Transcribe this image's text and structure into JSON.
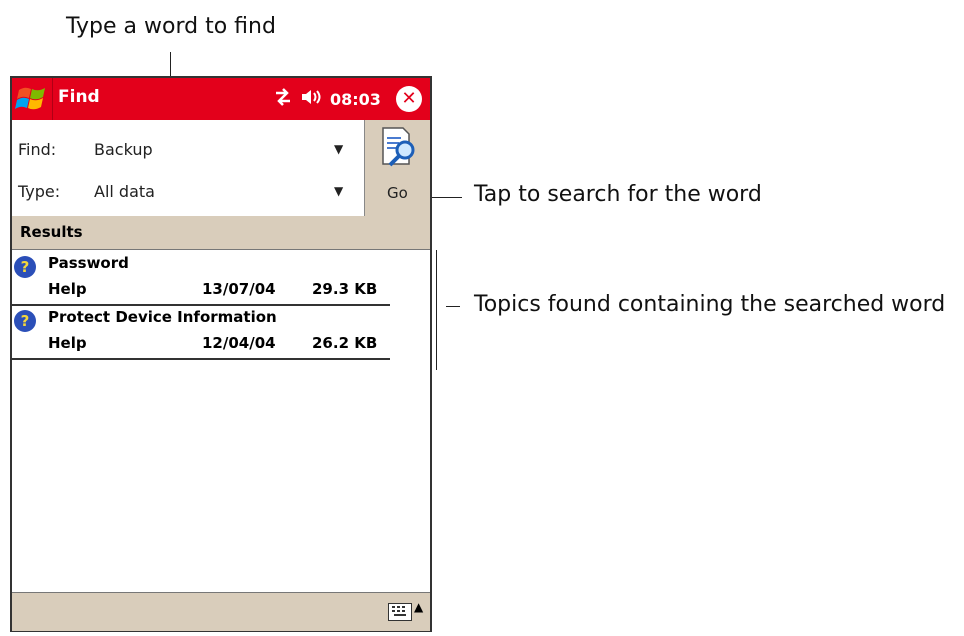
{
  "callouts": {
    "type_word": "Type a word to find",
    "tap_search": "Tap to search for the word",
    "topics_found": "Topics found containing the searched word"
  },
  "titlebar": {
    "app_title": "Find",
    "time": "08:03",
    "close": "✕"
  },
  "form": {
    "find_label": "Find:",
    "find_value": "Backup",
    "type_label": "Type:",
    "type_value": "All data",
    "go_label": "Go"
  },
  "results": {
    "header": "Results",
    "items": [
      {
        "name": "Password",
        "category": "Help",
        "date": "13/07/04",
        "size": "29.3 KB"
      },
      {
        "name": "Protect Device Information",
        "category": "Help",
        "date": "12/04/04",
        "size": "26.2 KB"
      }
    ]
  },
  "icons": {
    "start": "windows-flag-icon",
    "connectivity": "connectivity-icon",
    "speaker": "speaker-icon",
    "close": "close-icon",
    "find": "find-magnifier-icon",
    "help": "question-icon",
    "keyboard": "keyboard-icon"
  },
  "colors": {
    "titlebar": "#e3001b",
    "panel": "#d9cdbb"
  }
}
